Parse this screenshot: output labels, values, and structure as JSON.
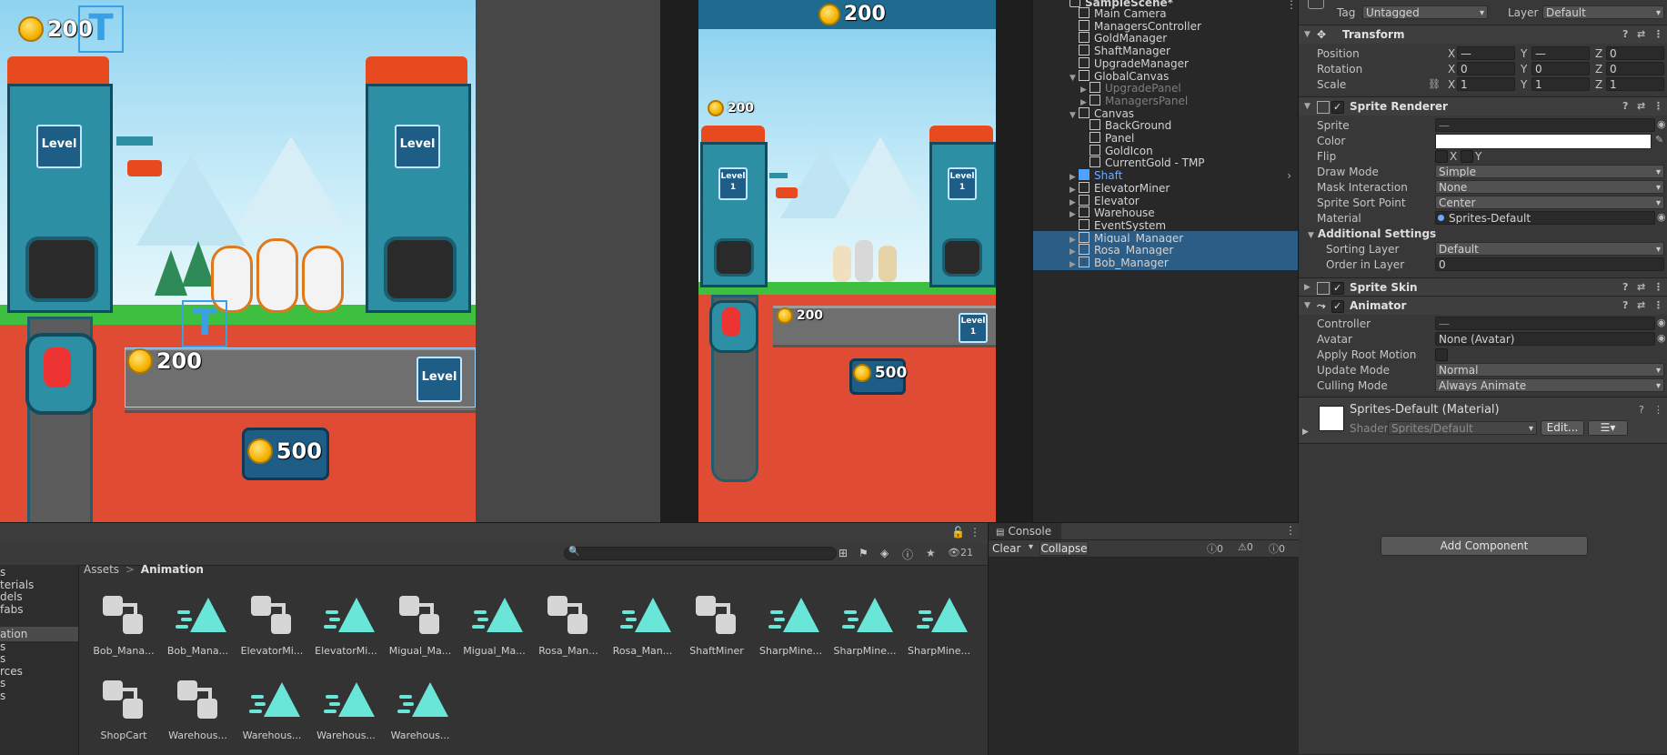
{
  "scene": {
    "coins_top": "200",
    "coins_tunnel": "200",
    "coins_bottom": "500",
    "level_label": "Level",
    "text_icon": "T"
  },
  "game": {
    "coins_header": "200",
    "coins_small": "200",
    "coins_tunnel": "200",
    "coins_bottom": "500",
    "level_left": "Level\n1",
    "level_right": "Level\n1",
    "level_tunnel": "Level\n1"
  },
  "hierarchy": {
    "scene_name": "SampleScene*",
    "items": [
      {
        "label": "Main Camera",
        "indent": 1,
        "state": "normal",
        "arrow": ""
      },
      {
        "label": "ManagersController",
        "indent": 1,
        "state": "normal",
        "arrow": ""
      },
      {
        "label": "GoldManager",
        "indent": 1,
        "state": "normal",
        "arrow": ""
      },
      {
        "label": "ShaftManager",
        "indent": 1,
        "state": "normal",
        "arrow": ""
      },
      {
        "label": "UpgradeManager",
        "indent": 1,
        "state": "normal",
        "arrow": ""
      },
      {
        "label": "GlobalCanvas",
        "indent": 1,
        "state": "normal",
        "arrow": "▼"
      },
      {
        "label": "UpgradePanel",
        "indent": 2,
        "state": "dim",
        "arrow": "▶"
      },
      {
        "label": "ManagersPanel",
        "indent": 2,
        "state": "dim",
        "arrow": "▶"
      },
      {
        "label": "Canvas",
        "indent": 1,
        "state": "normal",
        "arrow": "▼"
      },
      {
        "label": "BackGround",
        "indent": 2,
        "state": "normal",
        "arrow": ""
      },
      {
        "label": "Panel",
        "indent": 2,
        "state": "normal",
        "arrow": ""
      },
      {
        "label": "GoldIcon",
        "indent": 2,
        "state": "normal",
        "arrow": ""
      },
      {
        "label": "CurrentGold - TMP",
        "indent": 2,
        "state": "normal",
        "arrow": ""
      },
      {
        "label": "Shaft",
        "indent": 1,
        "state": "blue",
        "arrow": "▶"
      },
      {
        "label": "ElevatorMiner",
        "indent": 1,
        "state": "normal",
        "arrow": "▶"
      },
      {
        "label": "Elevator",
        "indent": 1,
        "state": "normal",
        "arrow": "▶"
      },
      {
        "label": "Warehouse",
        "indent": 1,
        "state": "normal",
        "arrow": "▶"
      },
      {
        "label": "EventSystem",
        "indent": 1,
        "state": "normal",
        "arrow": ""
      },
      {
        "label": "Migual_Manager",
        "indent": 1,
        "state": "sel",
        "arrow": "▶"
      },
      {
        "label": "Rosa_Manager",
        "indent": 1,
        "state": "sel",
        "arrow": "▶"
      },
      {
        "label": "Bob_Manager",
        "indent": 1,
        "state": "sel",
        "arrow": "▶"
      }
    ]
  },
  "inspector": {
    "tag_label": "Tag",
    "tag_value": "Untagged",
    "layer_label": "Layer",
    "layer_value": "Default",
    "transform_title": "Transform",
    "position_label": "Position",
    "rotation_label": "Rotation",
    "scale_label": "Scale",
    "pos": {
      "x": "—",
      "y": "—",
      "z": "0"
    },
    "rot": {
      "x": "0",
      "y": "0",
      "z": "0"
    },
    "scl": {
      "x": "1",
      "y": "1",
      "z": "1"
    },
    "axis_x": "X",
    "axis_y": "Y",
    "axis_z": "Z",
    "sprite_renderer_title": "Sprite Renderer",
    "sprite_label": "Sprite",
    "sprite_value": "—",
    "color_label": "Color",
    "flip_label": "Flip",
    "flip_x": "X",
    "flip_y": "Y",
    "draw_mode_label": "Draw Mode",
    "draw_mode_value": "Simple",
    "mask_label": "Mask Interaction",
    "mask_value": "None",
    "sort_point_label": "Sprite Sort Point",
    "sort_point_value": "Center",
    "material_label": "Material",
    "material_value": "Sprites-Default",
    "additional_title": "Additional Settings",
    "sorting_layer_label": "Sorting Layer",
    "sorting_layer_value": "Default",
    "order_label": "Order in Layer",
    "order_value": "0",
    "sprite_skin_title": "Sprite Skin",
    "animator_title": "Animator",
    "controller_label": "Controller",
    "controller_value": "—",
    "avatar_label": "Avatar",
    "avatar_value": "None (Avatar)",
    "root_motion_label": "Apply Root Motion",
    "update_mode_label": "Update Mode",
    "update_mode_value": "Normal",
    "culling_label": "Culling Mode",
    "culling_value": "Always Animate",
    "material_asset_title": "Sprites-Default (Material)",
    "shader_label": "Shader",
    "shader_value": "Sprites/Default",
    "edit_button": "Edit...",
    "add_component": "Add Component"
  },
  "project": {
    "breadcrumb_root": "Assets",
    "breadcrumb_sep": ">",
    "breadcrumb_current": "Animation",
    "hidden_count": "21",
    "tree": [
      {
        "label": "s",
        "sel": false
      },
      {
        "label": "terials",
        "sel": false
      },
      {
        "label": "dels",
        "sel": false
      },
      {
        "label": "fabs",
        "sel": false
      },
      {
        "label": "",
        "sel": false
      },
      {
        "label": "ation",
        "sel": true
      },
      {
        "label": "s",
        "sel": false
      },
      {
        "label": "s",
        "sel": false
      },
      {
        "label": "rces",
        "sel": false
      },
      {
        "label": "s",
        "sel": false
      },
      {
        "label": "s",
        "sel": false
      }
    ],
    "assets": [
      {
        "label": "Bob_Mana...",
        "kind": "ctrl"
      },
      {
        "label": "Bob_Mana...",
        "kind": "anim"
      },
      {
        "label": "ElevatorMi...",
        "kind": "ctrl"
      },
      {
        "label": "ElevatorMi...",
        "kind": "anim"
      },
      {
        "label": "Migual_Ma...",
        "kind": "ctrl"
      },
      {
        "label": "Migual_Ma...",
        "kind": "anim"
      },
      {
        "label": "Rosa_Man...",
        "kind": "ctrl"
      },
      {
        "label": "Rosa_Man...",
        "kind": "anim"
      },
      {
        "label": "ShaftMiner",
        "kind": "ctrl"
      },
      {
        "label": "SharpMine...",
        "kind": "anim"
      },
      {
        "label": "SharpMine...",
        "kind": "anim"
      },
      {
        "label": "SharpMine...",
        "kind": "anim"
      },
      {
        "label": "ShopCart",
        "kind": "ctrl"
      },
      {
        "label": "Warehous...",
        "kind": "ctrl"
      },
      {
        "label": "Warehous...",
        "kind": "anim"
      },
      {
        "label": "Warehous...",
        "kind": "anim"
      },
      {
        "label": "Warehous...",
        "kind": "anim"
      }
    ]
  },
  "console": {
    "tab_label": "Console",
    "clear_label": "Clear",
    "collapse_label": "Collapse",
    "count_info": "0",
    "count_warn": "0",
    "count_error": "0"
  },
  "colors": {
    "selection": "#2c5d87",
    "asset_icon": "#6ae6d8",
    "panel_bg": "#383838"
  }
}
